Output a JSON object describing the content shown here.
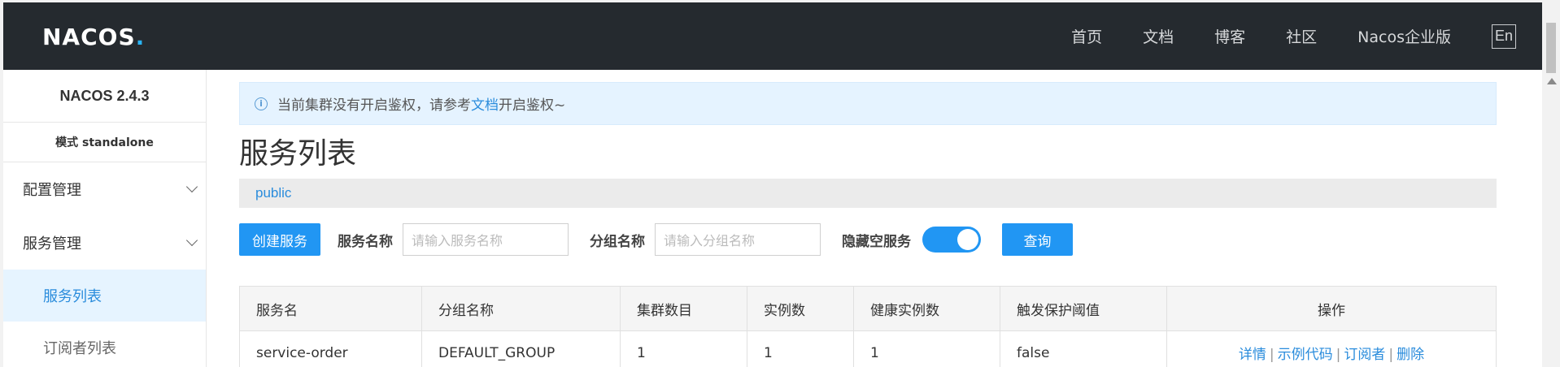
{
  "header": {
    "logo_main": "NACOS",
    "logo_dot": ".",
    "nav": [
      "首页",
      "文档",
      "博客",
      "社区",
      "Nacos企业版"
    ],
    "lang": "En"
  },
  "sidebar": {
    "version": "NACOS 2.4.3",
    "mode": "模式 standalone",
    "groups": [
      {
        "label": "配置管理"
      },
      {
        "label": "服务管理"
      }
    ],
    "subs": [
      {
        "label": "服务列表",
        "active": true
      },
      {
        "label": "订阅者列表",
        "active": false
      }
    ]
  },
  "notice": {
    "text_before": "当前集群没有开启鉴权，请参考",
    "link": "文档",
    "text_after": "开启鉴权~"
  },
  "page_title": "服务列表",
  "namespace": "public",
  "filter": {
    "create_button": "创建服务",
    "service_name_label": "服务名称",
    "service_name_placeholder": "请输入服务名称",
    "group_name_label": "分组名称",
    "group_name_placeholder": "请输入分组名称",
    "hide_empty_label": "隐藏空服务",
    "hide_empty_on": true,
    "query_button": "查询"
  },
  "table": {
    "columns": [
      "服务名",
      "分组名称",
      "集群数目",
      "实例数",
      "健康实例数",
      "触发保护阈值",
      "操作"
    ],
    "rows": [
      {
        "service": "service-order",
        "group": "DEFAULT_GROUP",
        "clusters": "1",
        "instances": "1",
        "healthy": "1",
        "threshold": "false",
        "ops": [
          "详情",
          "示例代码",
          "订阅者",
          "删除"
        ]
      }
    ]
  },
  "colors": {
    "header_bg": "#252a2f",
    "accent": "#2196f3",
    "link": "#2a8cdc",
    "active_bg": "#e6f4ff"
  }
}
